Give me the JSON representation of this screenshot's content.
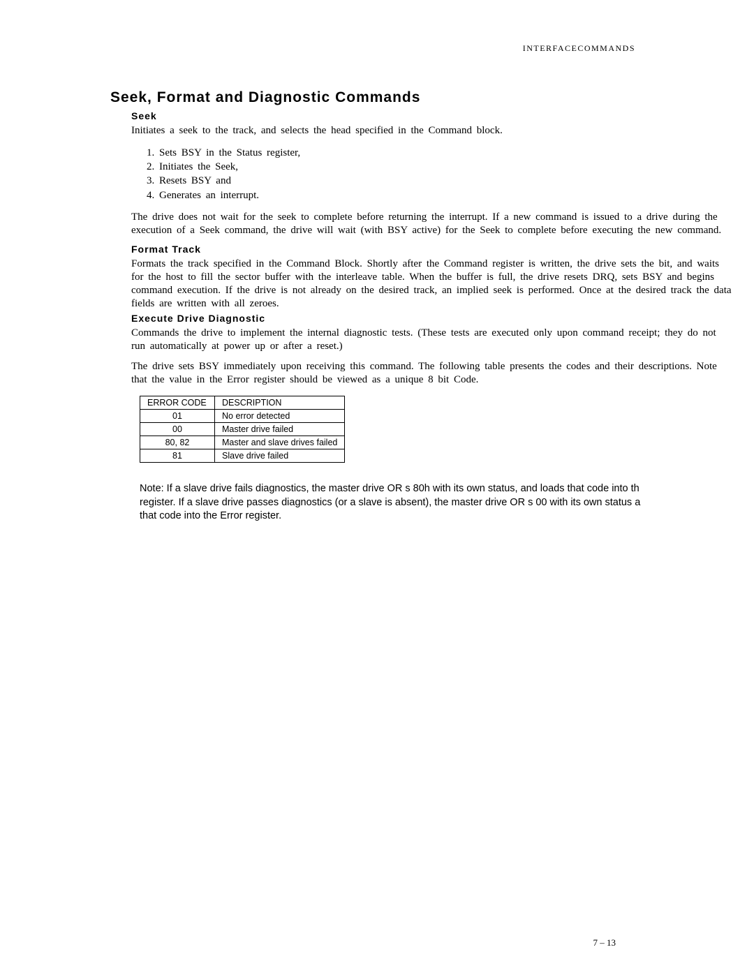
{
  "header": {
    "right": "INTERFACECOMMANDS"
  },
  "title": "Seek, Format and Diagnostic Commands",
  "seek": {
    "heading": "Seek",
    "intro": "Initiates a seek to the track, and selects the head specified in the Command block.",
    "steps": [
      "Sets BSY in the Status register,",
      "Initiates the Seek,",
      "Resets BSY and",
      "Generates an interrupt."
    ],
    "after": "The drive does not wait for the seek to complete before returning the interrupt. If a new command is issued to a drive during the execution of a Seek command, the drive will wait (with BSY active) for the Seek to complete before executing the new command."
  },
  "format": {
    "heading": "Format  Track",
    "body": "Formats the track specified in the Command Block. Shortly after the Command register is written, the drive sets the  bit, and waits for the host to fill the sector buffer with the interleave table. When the buffer is full, the drive resets DRQ, sets BSY and begins command execution. If the drive is not already on the desired track, an implied seek is performed. Once at the desired track the data fields are written with all zeroes."
  },
  "diag": {
    "heading": "Execute  Drive  Diagnostic",
    "p1": "Commands the drive to implement the internal diagnostic tests. (These tests are executed only upon command receipt; they do not run automatically at power up or after a reset.)",
    "p2": "The drive sets BSY immediately upon receiving this command. The following table presents the codes and their descriptions. Note that the value in the Error register should be viewed as a unique 8 bit Code."
  },
  "table": {
    "head_code": "ERROR CODE",
    "head_desc": "DESCRIPTION",
    "rows": [
      {
        "code": "01",
        "desc": "No error detected"
      },
      {
        "code": "00",
        "desc": "Master drive failed"
      },
      {
        "code": "80, 82",
        "desc": "Master and slave drives failed"
      },
      {
        "code": "81",
        "desc": "Slave drive failed"
      }
    ]
  },
  "note": {
    "l1": "Note: If a slave drive fails diagnostics, the master drive OR s 80h with its own status, and loads that code into th",
    "l2": "register. If a slave drive passes diagnostics (or a slave is absent), the master drive OR s 00 with its own status a",
    "l3": "that code into the Error register."
  },
  "page_num": "7 – 13"
}
